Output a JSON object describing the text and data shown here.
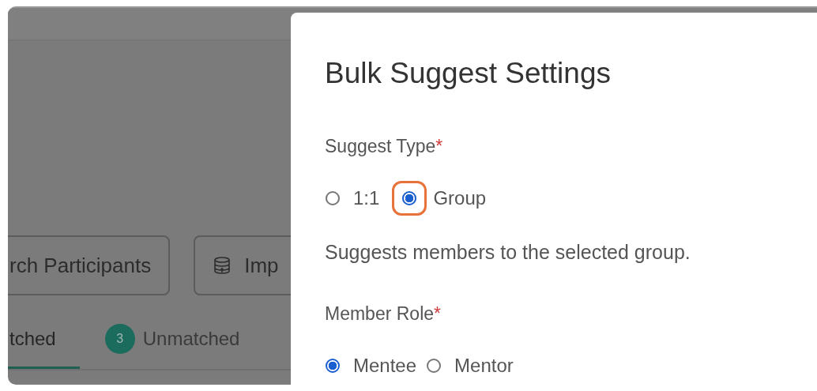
{
  "background": {
    "buttons": [
      {
        "label": "rch Participants",
        "icon": false
      },
      {
        "label": "Imp",
        "icon": true
      }
    ],
    "tabs": [
      {
        "label": "tched",
        "selected": true
      },
      {
        "label": "Unmatched",
        "badge": "3",
        "selected": false
      }
    ]
  },
  "panel": {
    "title": "Bulk Suggest Settings",
    "sections": [
      {
        "label": "Suggest Type",
        "required_mark": "*",
        "options": [
          {
            "label": "1:1",
            "selected": false,
            "highlighted": false
          },
          {
            "label": "Group",
            "selected": true,
            "highlighted": true
          }
        ],
        "description": "Suggests members to the selected group."
      },
      {
        "label": "Member Role",
        "required_mark": "*",
        "options": [
          {
            "label": "Mentee",
            "selected": true,
            "highlighted": false
          },
          {
            "label": "Mentor",
            "selected": false,
            "highlighted": false
          }
        ]
      }
    ]
  }
}
